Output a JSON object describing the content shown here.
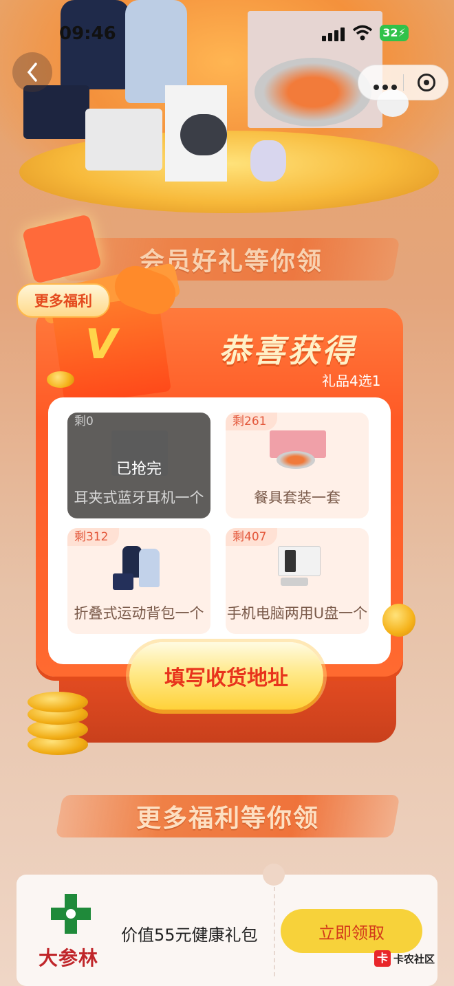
{
  "status_bar": {
    "time": "09:46",
    "battery": "32"
  },
  "banners": {
    "top": "会员好礼等你领",
    "bottom": "更多福利等你领"
  },
  "more_tag": "更多福利",
  "modal": {
    "title": "恭喜获得",
    "subtitle": "礼品4选1",
    "items": [
      {
        "remain": "剩0",
        "name": "耳夹式蓝牙耳机一个",
        "status": "已抢完"
      },
      {
        "remain": "剩261",
        "name": "餐具套装一套"
      },
      {
        "remain": "剩312",
        "name": "折叠式运动背包一个"
      },
      {
        "remain": "剩407",
        "name": "手机电脑两用U盘一个"
      }
    ],
    "button": "填写收货地址"
  },
  "ticket": {
    "brand": "大参林",
    "offer": "价值55元健康礼包",
    "button": "立即领取"
  },
  "watermark": "卡农社区",
  "colors": {
    "accent": "#ff5a26",
    "button_text": "#e8331c",
    "claim_bg": "#f7d23a",
    "brand": "#c0262a"
  }
}
